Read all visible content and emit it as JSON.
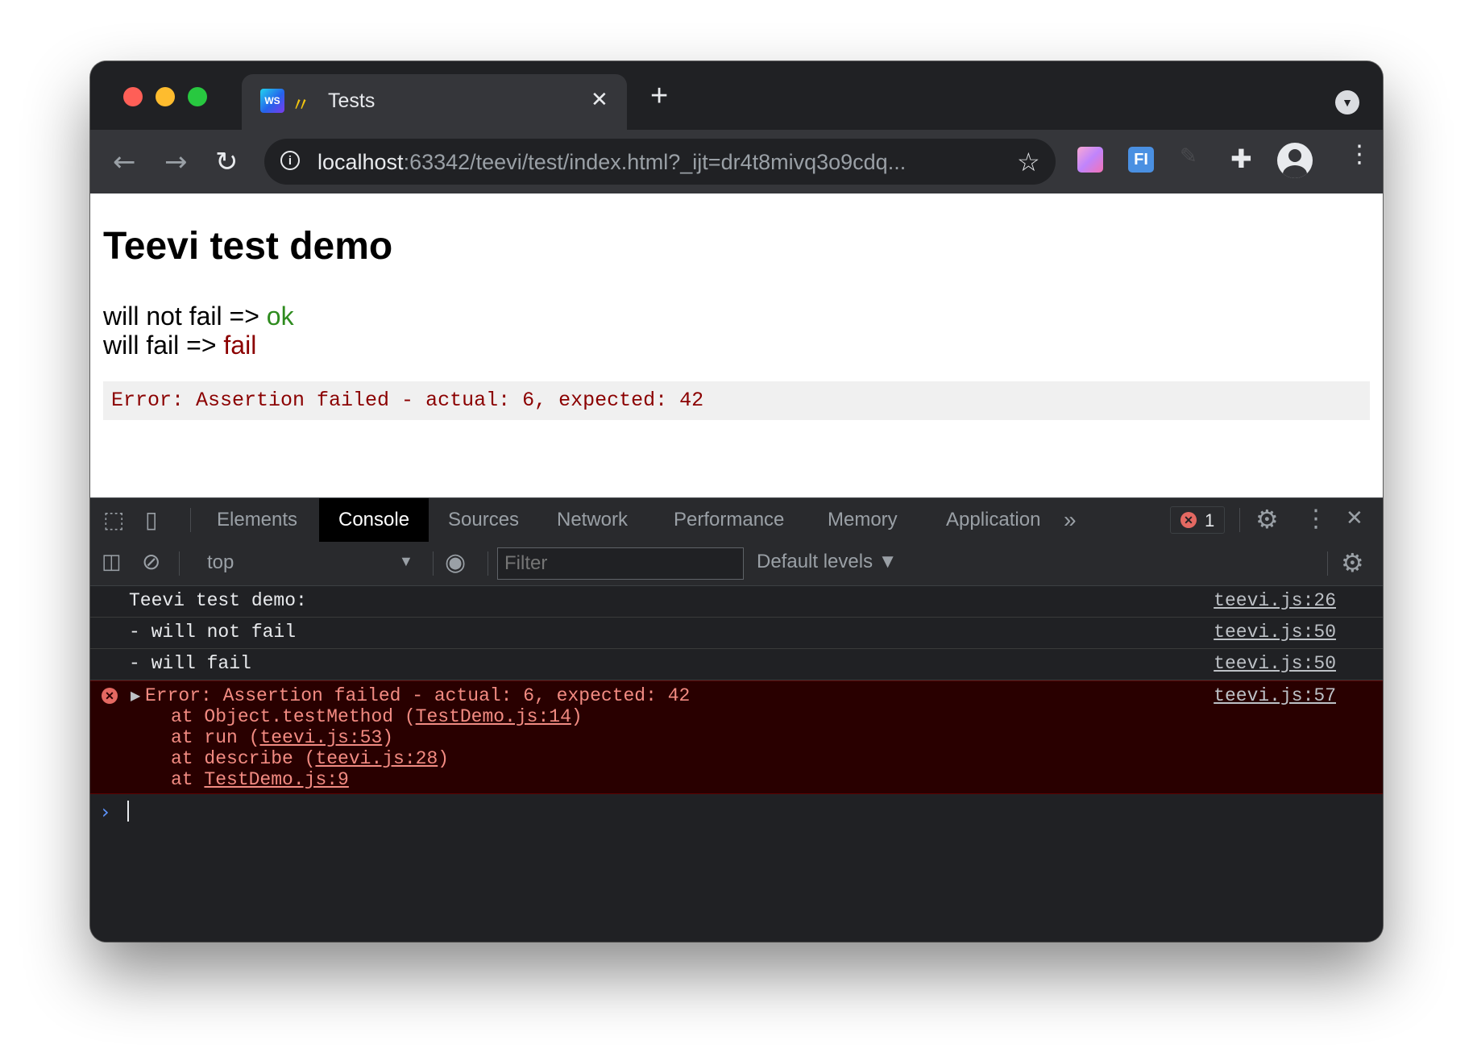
{
  "window": {
    "tab": {
      "title": "Tests",
      "favicon_text": "WS",
      "emoji": "〃"
    },
    "new_tab": "+",
    "url": {
      "host": "localhost",
      "rest": ":63342/teevi/test/index.html?_ijt=dr4t8mivq3o9cdq..."
    },
    "extensions": {
      "fi_label": "FI"
    }
  },
  "page": {
    "title": "Teevi test demo",
    "results": [
      {
        "label": "will not fail => ",
        "status": "ok"
      },
      {
        "label": "will fail => ",
        "status": "fail"
      }
    ],
    "error_message": "Error: Assertion failed - actual: 6, expected: 42"
  },
  "devtools": {
    "tabs": [
      "Elements",
      "Console",
      "Sources",
      "Network",
      "Performance",
      "Memory",
      "Application"
    ],
    "more": "»",
    "error_count": "1",
    "context": "top",
    "filter_placeholder": "Filter",
    "levels": "Default levels ▼",
    "console": {
      "logs": [
        {
          "message": "Teevi test demo:",
          "source": "teevi.js:26"
        },
        {
          "message": "- will not fail",
          "source": "teevi.js:50"
        },
        {
          "message": "- will fail",
          "source": "teevi.js:50"
        }
      ],
      "error": {
        "message": "Error: Assertion failed - actual: 6, expected: 42",
        "source": "teevi.js:57",
        "stack": [
          {
            "prefix": "at Object.testMethod (",
            "link": "TestDemo.js:14",
            "suffix": ")"
          },
          {
            "prefix": "at run (",
            "link": "teevi.js:53",
            "suffix": ")"
          },
          {
            "prefix": "at describe (",
            "link": "teevi.js:28",
            "suffix": ")"
          },
          {
            "prefix": "at ",
            "link": "TestDemo.js:9",
            "suffix": ""
          }
        ]
      }
    }
  },
  "colors": {
    "ok": "#2e8b1e",
    "fail": "#8b0000",
    "console_error_bg": "#290000",
    "console_error_text": "#f28b82"
  }
}
